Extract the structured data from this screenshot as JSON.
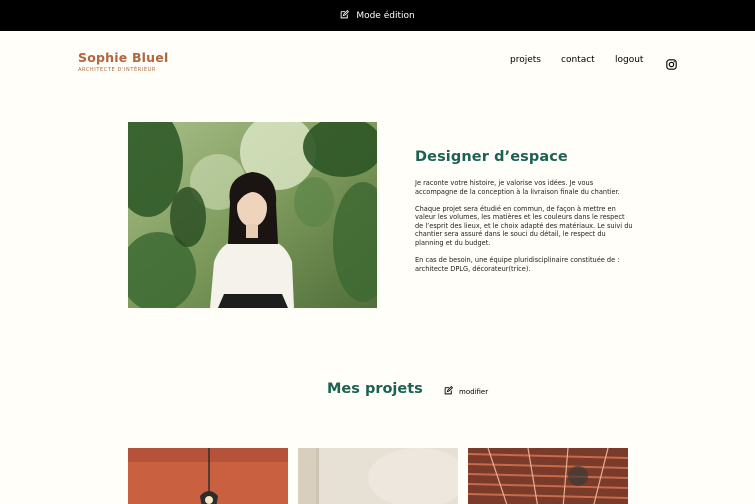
{
  "edit_bar": {
    "label": "Mode édition",
    "icon": "edit-icon"
  },
  "logo": {
    "name": "Sophie Bluel",
    "subtitle": "Architecte d'intérieur"
  },
  "nav": {
    "items": [
      {
        "label": "projets"
      },
      {
        "label": "contact"
      },
      {
        "label": "logout"
      }
    ],
    "instagram_icon": "instagram-icon"
  },
  "intro": {
    "title": "Designer d’espace",
    "paragraphs": [
      "Je raconte votre histoire, je valorise vos idées. Je vous accompagne de la conception à la livraison finale du chantier.",
      "Chaque projet sera étudié en commun, de façon à mettre en valeur les volumes, les matières et les couleurs dans le respect de l’esprit des lieux, et le choix adapté des matériaux. Le suivi du chantier sera assuré dans le souci du détail, le respect du planning et du budget.",
      "En cas de besoin, une équipe pluridisciplinaire constituée de : architecte DPLG, décorateur(trice)."
    ]
  },
  "projects": {
    "title": "Mes projets",
    "modifier_label": "modifier",
    "modifier_icon": "edit-icon"
  },
  "colors": {
    "accent": "#1D6154",
    "brand": "#B1663C",
    "background": "#FFFEF8",
    "edit_bar": "#000000"
  }
}
